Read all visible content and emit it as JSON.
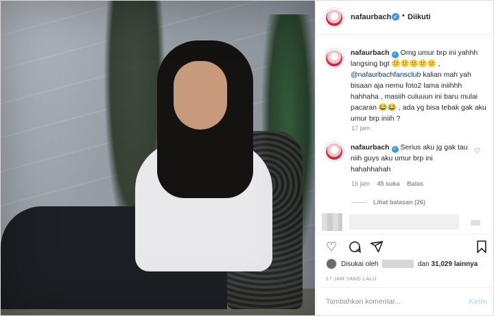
{
  "post": {
    "username": "nafaurbach",
    "follow_status": "Diikuti",
    "dot": "•"
  },
  "caption": {
    "text_1": " Omg umur brp ini yahhh langsing bgt 😕😕😕😕😕 ,",
    "mention": "@nafaurbachfansclub",
    "text_2": " kalian mah yah bisaan aja nemu foto2 lama iniihhh hahhaha , masiih culuuun ini baru mulai pacaran 😂😂 , ada yg bisa tebak gak aku umur brp iniih ?",
    "time": "17 jam"
  },
  "comment": {
    "text": " Serius aku jg gak tau niih guys aku umur brp ini hahahhahah",
    "time": "16 jam",
    "likes": "45 suka",
    "reply": "Balas",
    "view_replies": "Lihat balasan (26)"
  },
  "icons": {
    "heart": "heart-icon",
    "comment": "comment-icon",
    "share": "share-icon",
    "bookmark": "bookmark-icon",
    "verified": "verified-badge-icon"
  },
  "likes_line": {
    "prefix": "Disukai oleh",
    "suffix_pre": "dan",
    "count": "31,029",
    "suffix": "lainnya"
  },
  "date": "17 JAM YANG LALU",
  "comment_box": {
    "placeholder": "Tambahkan komentar...",
    "send": "Kirim"
  },
  "colors": {
    "verified": "#3897f0",
    "mention": "#003569",
    "send_disabled": "#b2dffc"
  }
}
